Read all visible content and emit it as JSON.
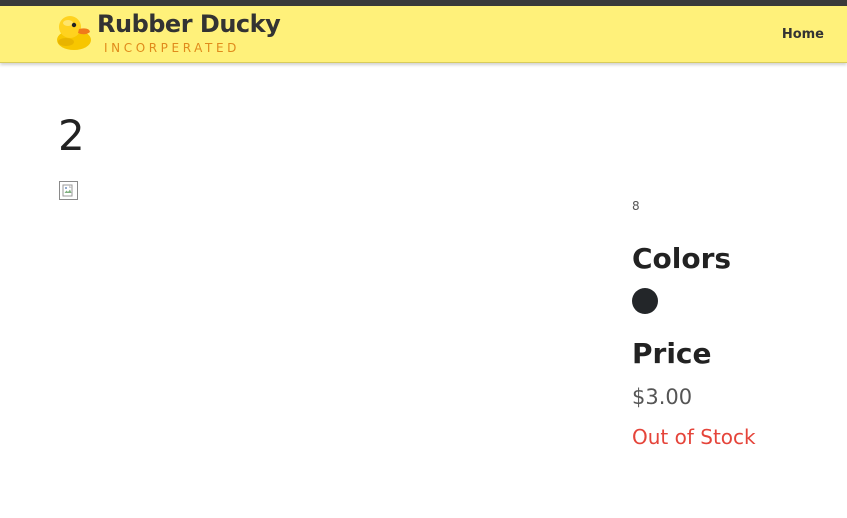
{
  "header": {
    "brand_name": "Rubber Ducky",
    "brand_subtitle": "INCORPERATED",
    "nav": {
      "home_label": "Home"
    },
    "colors": {
      "bar": "#fff17a",
      "subtitle": "#e08a1b"
    }
  },
  "product": {
    "title": "2",
    "image_icon": "broken-image-icon",
    "quantity": "8",
    "colors_heading": "Colors",
    "color_swatches": [
      "#232629"
    ],
    "price_heading": "Price",
    "price": "$3.00",
    "stock_status": "Out of Stock",
    "stock_color": "#e5443a"
  }
}
